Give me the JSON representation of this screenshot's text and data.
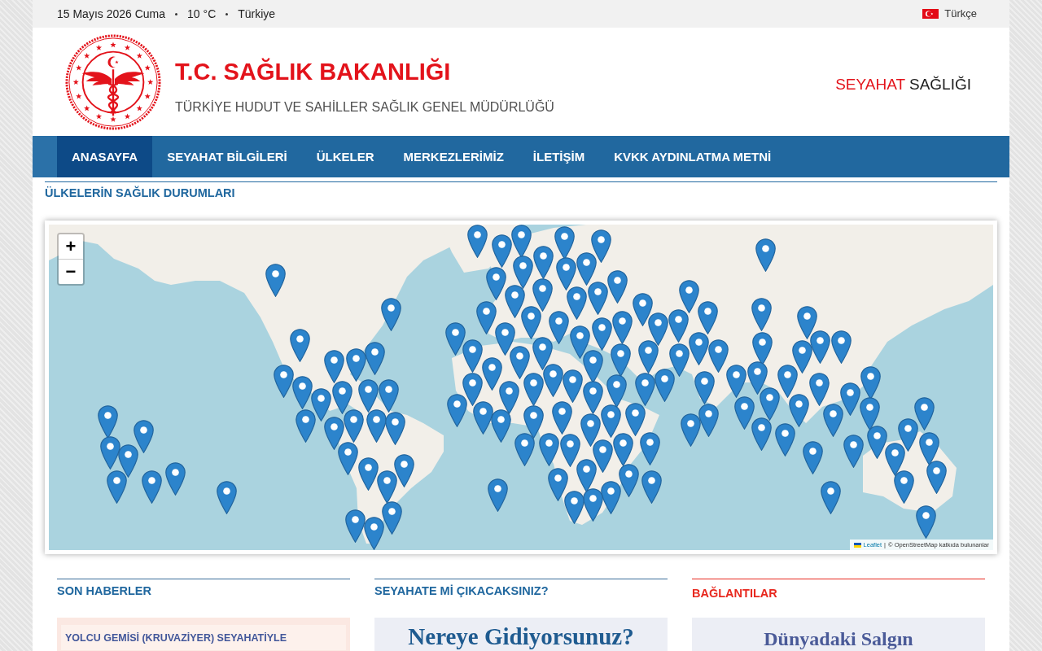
{
  "top_bar": {
    "date": "15 Mayıs 2026 Cuma",
    "temperature": "10 °C",
    "location": "Türkiye",
    "language": "Türkçe"
  },
  "header": {
    "title": "T.C. SAĞLIK BAKANLIĞI",
    "subtitle": "TÜRKİYE HUDUT VE SAHİLLER SAĞLIK GENEL MÜDÜRLÜĞÜ",
    "site_name": {
      "accent": "SEYAHAT",
      "rest": "SAĞLIĞI"
    }
  },
  "nav": [
    {
      "label": "ANASAYFA",
      "selected": true
    },
    {
      "label": "SEYAHAT BİLGİLERİ",
      "selected": false
    },
    {
      "label": "ÜLKELER",
      "selected": false
    },
    {
      "label": "MERKEZLERİMİZ",
      "selected": false
    },
    {
      "label": "İLETİŞİM",
      "selected": false
    },
    {
      "label": "KVKK AYDINLATMA METNİ",
      "selected": false
    }
  ],
  "section_title": "ÜLKELERİN SAĞLIK DURUMLARI",
  "map": {
    "zoom_in": "+",
    "zoom_out": "−",
    "attribution_link": "Leaflet",
    "attribution_separator": "|",
    "attribution": "© OpenStreetMap katkıda bulunanlar"
  },
  "columns": [
    {
      "kind": "news",
      "title": "SON HABERLER",
      "items": [
        "YOLCU GEMİSİ (KRUVAZİYER) SEYAHATİYLE"
      ]
    },
    {
      "kind": "promo",
      "title": "SEYAHATE Mİ ÇIKACAKSINIZ?",
      "text": "Nereye Gidiyorsunuz?"
    },
    {
      "kind": "links",
      "title": "BAĞLANTILAR",
      "text": "Dünyadaki Salgın"
    }
  ]
}
